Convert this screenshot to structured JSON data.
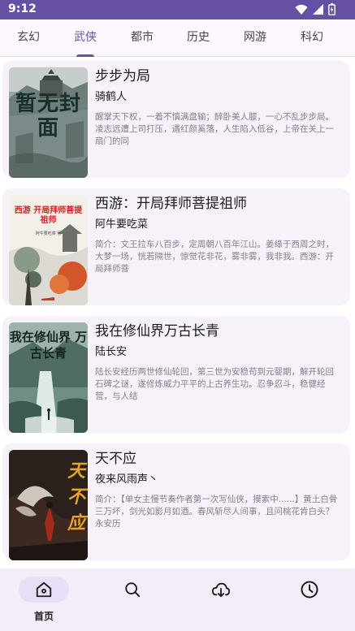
{
  "status_bar": {
    "time": "9:12"
  },
  "tabs": [
    {
      "label": "玄幻"
    },
    {
      "label": "武侠",
      "active": true
    },
    {
      "label": "都市"
    },
    {
      "label": "历史"
    },
    {
      "label": "网游"
    },
    {
      "label": "科幻"
    }
  ],
  "books": [
    {
      "title": "步步为局",
      "author": "骑鹤人",
      "description": "醒掌天下权，一着不慎满盘输；醉卧美人膝，一心不乱步步局。凌志远遭上司打压，遇红颜奚落，人生陷入低谷，上帝在关上一扇门的同",
      "cover_text": "暂无封面",
      "cover_icon": "placeholder-cover"
    },
    {
      "title": "西游：开局拜师菩提祖师",
      "author": "阿牛要吃菜",
      "description": "简介：文王拉车八百步，定周朝八百年江山。姜缘于西周之时，大梦一场，恍若隔世，惊觉花非花，雾非雾，我非我。西游：开局拜师菩",
      "cover_text": "西游 开局拜师菩提祖师",
      "cover_subtext": "阿牛要吃菜 著",
      "cover_icon": "ink-painting-cover"
    },
    {
      "title": "我在修仙界万古长青",
      "author": "陆长安",
      "description": "陆长安经历两世修仙轮回，第三世为安稳苟到元婴期，解开轮回石碑之谜，遂修炼威力平平的上古养生功。忍争忍斗，稳健经营，与人结",
      "cover_text": "我在修仙界 万古长青",
      "cover_icon": "waterfall-cover"
    },
    {
      "title": "天不应",
      "author": "夜来风雨声丶",
      "description": "简介：【单女主慢节奏作者第一次写仙侠，摸索中......】黄土白骨三万坏，剑光如影月如酒。春风斩尽人间事，且问桃花肯白头？永安历",
      "cover_text": "天不应",
      "cover_icon": "dragon-cover"
    }
  ],
  "bottom_nav": [
    {
      "label": "首页",
      "icon": "home-icon",
      "active": true
    },
    {
      "label": "",
      "icon": "search-icon"
    },
    {
      "label": "",
      "icon": "download-cloud-icon"
    },
    {
      "label": "",
      "icon": "history-clock-icon"
    }
  ],
  "colors": {
    "primary": "#6650a4",
    "card_bg": "#f7f2fa",
    "nav_bg": "#f3edf7",
    "active_pill": "#e8def8",
    "description_text": "#857d8c"
  }
}
